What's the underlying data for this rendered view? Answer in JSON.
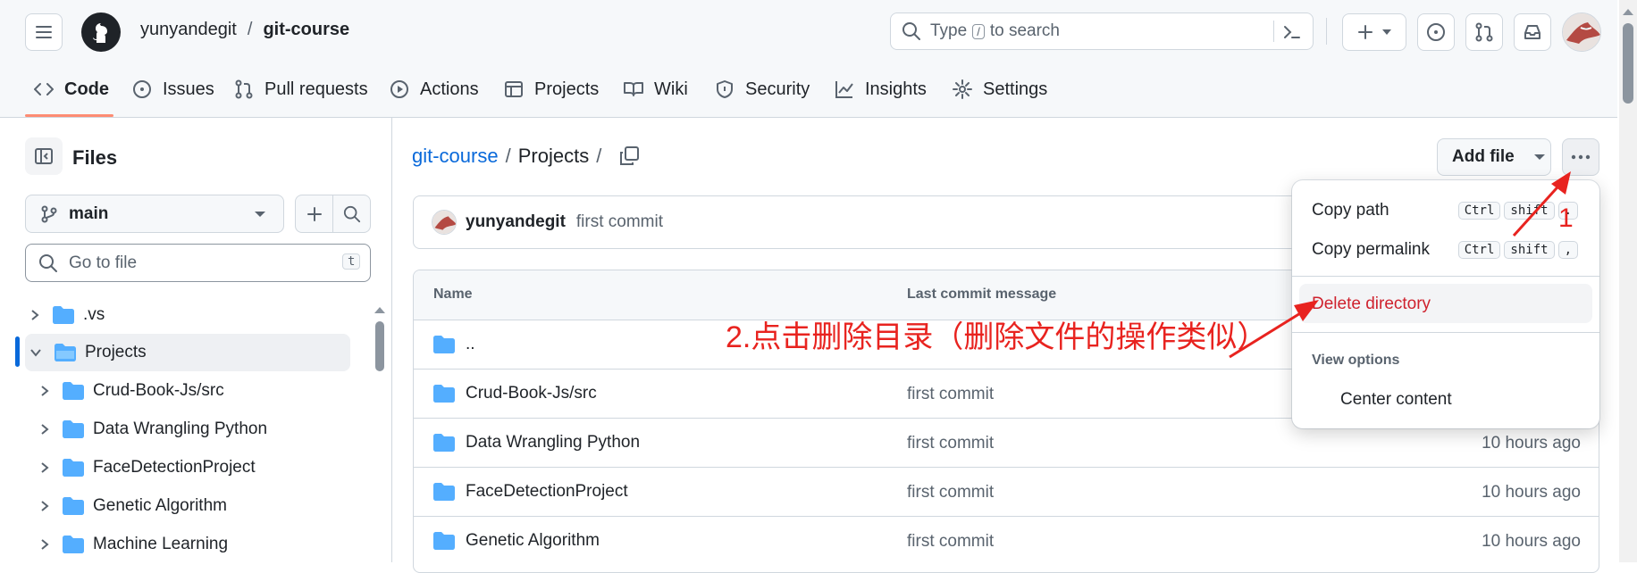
{
  "header": {
    "owner": "yunyandegit",
    "separator": "/",
    "repo": "git-course",
    "search_placeholder": "Type / to search",
    "search_part1": "Type",
    "search_key": "/",
    "search_part2": "to search"
  },
  "tabs": [
    {
      "label": "Code",
      "icon": "code-icon"
    },
    {
      "label": "Issues",
      "icon": "issue-icon"
    },
    {
      "label": "Pull requests",
      "icon": "pull-request-icon"
    },
    {
      "label": "Actions",
      "icon": "play-icon"
    },
    {
      "label": "Projects",
      "icon": "table-icon"
    },
    {
      "label": "Wiki",
      "icon": "book-icon"
    },
    {
      "label": "Security",
      "icon": "shield-icon"
    },
    {
      "label": "Insights",
      "icon": "graph-icon"
    },
    {
      "label": "Settings",
      "icon": "gear-icon"
    }
  ],
  "sidebar": {
    "title": "Files",
    "branch": "main",
    "goto_placeholder": "Go to file",
    "goto_key": "t",
    "tree": [
      {
        "label": ".vs",
        "expanded": false,
        "level": 0
      },
      {
        "label": "Projects",
        "expanded": true,
        "level": 0,
        "selected": true
      },
      {
        "label": "Crud-Book-Js/src",
        "expanded": false,
        "level": 1
      },
      {
        "label": "Data Wrangling Python",
        "expanded": false,
        "level": 1
      },
      {
        "label": "FaceDetectionProject",
        "expanded": false,
        "level": 1
      },
      {
        "label": "Genetic Algorithm",
        "expanded": false,
        "level": 1
      },
      {
        "label": "Machine Learning",
        "expanded": false,
        "level": 1
      }
    ]
  },
  "breadcrumb": {
    "repo": "git-course",
    "sep": "/",
    "folder": "Projects",
    "trailing": "/"
  },
  "toolbar": {
    "add_file": "Add file"
  },
  "commit": {
    "author": "yunyandegit",
    "message": "first commit"
  },
  "table": {
    "col_name": "Name",
    "col_message": "Last commit message",
    "rows": [
      {
        "name": "..",
        "message": "",
        "time": ""
      },
      {
        "name": "Crud-Book-Js/src",
        "message": "first commit",
        "time": ""
      },
      {
        "name": "Data Wrangling Python",
        "message": "first commit",
        "time": "10 hours ago"
      },
      {
        "name": "FaceDetectionProject",
        "message": "first commit",
        "time": "10 hours ago"
      },
      {
        "name": "Genetic Algorithm",
        "message": "first commit",
        "time": "10 hours ago"
      }
    ]
  },
  "menu": {
    "copy_path": "Copy path",
    "copy_path_keys": [
      "Ctrl",
      "shift",
      "."
    ],
    "copy_permalink": "Copy permalink",
    "copy_permalink_keys": [
      "Ctrl",
      "shift",
      ","
    ],
    "delete_directory": "Delete directory",
    "view_options": "View options",
    "center_content": "Center content"
  },
  "annotations": {
    "step1": "1",
    "step2": "2.点击删除目录（删除文件的操作类似）",
    "color": "#e8231f"
  },
  "colors": {
    "link": "#0969da",
    "folder": "#54aeff",
    "danger": "#cf222e",
    "accent": "#fd8c73",
    "muted": "#59636e"
  }
}
